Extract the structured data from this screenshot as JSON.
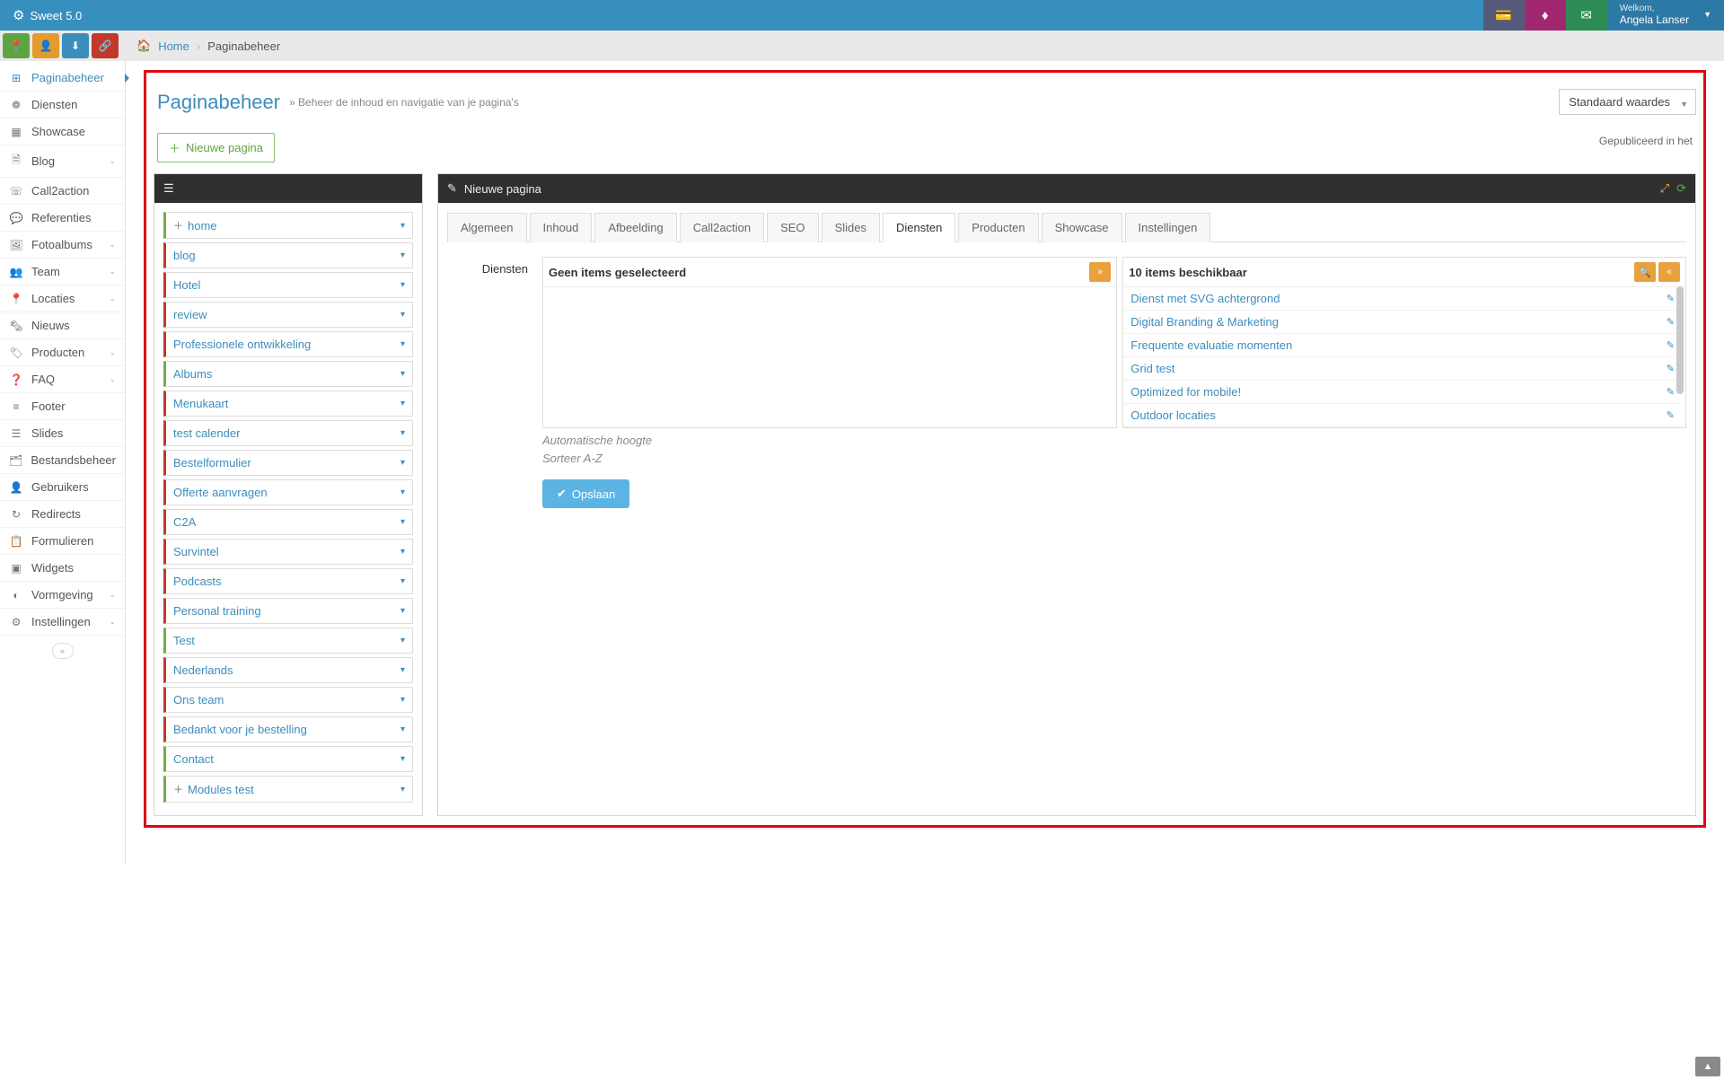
{
  "brand": "Sweet 5.0",
  "user": {
    "welcome": "Welkom,",
    "name": "Angela Lanser"
  },
  "breadcrumb": {
    "home": "Home",
    "current": "Paginabeheer"
  },
  "sidebar": [
    {
      "icon": "⊞",
      "label": "Paginabeheer",
      "active": true
    },
    {
      "icon": "❁",
      "label": "Diensten"
    },
    {
      "icon": "▦",
      "label": "Showcase"
    },
    {
      "icon": "🗎",
      "label": "Blog",
      "chev": true
    },
    {
      "icon": "☏",
      "label": "Call2action"
    },
    {
      "icon": "💬",
      "label": "Referenties"
    },
    {
      "icon": "🖼",
      "label": "Fotoalbums",
      "chev": true
    },
    {
      "icon": "👥",
      "label": "Team",
      "chev": true
    },
    {
      "icon": "📍",
      "label": "Locaties",
      "chev": true
    },
    {
      "icon": "🗞",
      "label": "Nieuws"
    },
    {
      "icon": "🏷",
      "label": "Producten",
      "chev": true
    },
    {
      "icon": "❓",
      "label": "FAQ",
      "chev": true
    },
    {
      "icon": "≡",
      "label": "Footer"
    },
    {
      "icon": "☰",
      "label": "Slides"
    },
    {
      "icon": "🗂",
      "label": "Bestandsbeheer"
    },
    {
      "icon": "👤",
      "label": "Gebruikers"
    },
    {
      "icon": "↻",
      "label": "Redirects"
    },
    {
      "icon": "📋",
      "label": "Formulieren"
    },
    {
      "icon": "▣",
      "label": "Widgets"
    },
    {
      "icon": "◐",
      "label": "Vormgeving",
      "chev": true
    },
    {
      "icon": "⚙",
      "label": "Instellingen",
      "chev": true
    }
  ],
  "page": {
    "title": "Paginabeheer",
    "subtitle": "» Beheer de inhoud en navigatie van je pagina's",
    "default_dd": "Standaard waardes",
    "new_page_btn": "Nieuwe pagina",
    "published_note": "Gepubliceerd in het"
  },
  "tree": [
    {
      "label": "home",
      "color": "green",
      "plus": true
    },
    {
      "label": "blog",
      "color": "red"
    },
    {
      "label": "Hotel",
      "color": "red"
    },
    {
      "label": "review",
      "color": "red"
    },
    {
      "label": "Professionele ontwikkeling",
      "color": "red"
    },
    {
      "label": "Albums",
      "color": "green"
    },
    {
      "label": "Menukaart",
      "color": "red"
    },
    {
      "label": "test calender",
      "color": "red"
    },
    {
      "label": "Bestelformulier",
      "color": "red"
    },
    {
      "label": "Offerte aanvragen",
      "color": "red"
    },
    {
      "label": "C2A",
      "color": "red"
    },
    {
      "label": "Survintel",
      "color": "red"
    },
    {
      "label": "Podcasts",
      "color": "red"
    },
    {
      "label": "Personal training",
      "color": "red"
    },
    {
      "label": "Test",
      "color": "green"
    },
    {
      "label": "Nederlands",
      "color": "red"
    },
    {
      "label": "Ons team",
      "color": "red"
    },
    {
      "label": "Bedankt voor je bestelling",
      "color": "red"
    },
    {
      "label": "Contact",
      "color": "green"
    },
    {
      "label": "Modules test",
      "color": "green",
      "plus": true
    }
  ],
  "editor": {
    "panel_title": "Nieuwe pagina",
    "tabs": [
      "Algemeen",
      "Inhoud",
      "Afbeelding",
      "Call2action",
      "SEO",
      "Slides",
      "Diensten",
      "Producten",
      "Showcase",
      "Instellingen"
    ],
    "active_tab": "Diensten",
    "form_label": "Diensten",
    "left_title": "Geen items geselecteerd",
    "right_title": "10 items beschikbaar",
    "available": [
      "Dienst met SVG achtergrond",
      "Digital Branding & Marketing",
      "Frequente evaluatie momenten",
      "Grid test",
      "Optimized for mobile!",
      "Outdoor locaties"
    ],
    "hint1": "Automatische hoogte",
    "hint2": "Sorteer A-Z",
    "save": "Opslaan"
  }
}
